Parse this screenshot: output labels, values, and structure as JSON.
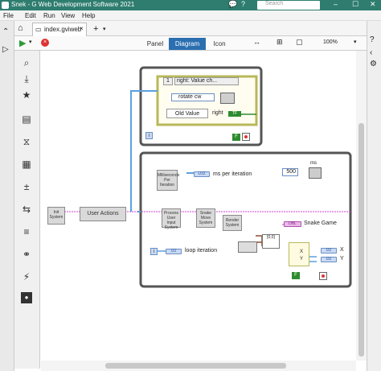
{
  "window": {
    "title": "Snek - G Web Development Software 2021",
    "search_placeholder": "Search"
  },
  "menu": [
    "File",
    "Edit",
    "Run",
    "View",
    "Help"
  ],
  "tab": {
    "label": "index.gviweb",
    "add": "+"
  },
  "view_tabs": [
    "Panel",
    "Diagram",
    "Icon"
  ],
  "zoom": "100%",
  "diagram": {
    "case_selector": "right: Value ch...",
    "event_index": "1",
    "rotate_label": "rotate cw",
    "old_value_label": "Old Value",
    "right_label": "right",
    "tf_label": "TF",
    "info_i": "i",
    "ms_label": "ms",
    "ms_value": "500",
    "ms_per_iteration": "ms per iteration",
    "loop_iteration": "loop iteration",
    "snake_game": "Snake Game",
    "x_label": "X",
    "y_label": "Y",
    "user_actions": "User Actions",
    "nodes": {
      "init": "Init System",
      "ms_counter": "Milliseconds Per Iteration",
      "process_input": "Process User Input System",
      "snake_move": "Snake Move System",
      "render": "Render System"
    },
    "term_i32": "I32",
    "term_u32": "U32",
    "term_dbl": "DBL",
    "f_const": "F",
    "bundle_label": "[0,0]"
  }
}
